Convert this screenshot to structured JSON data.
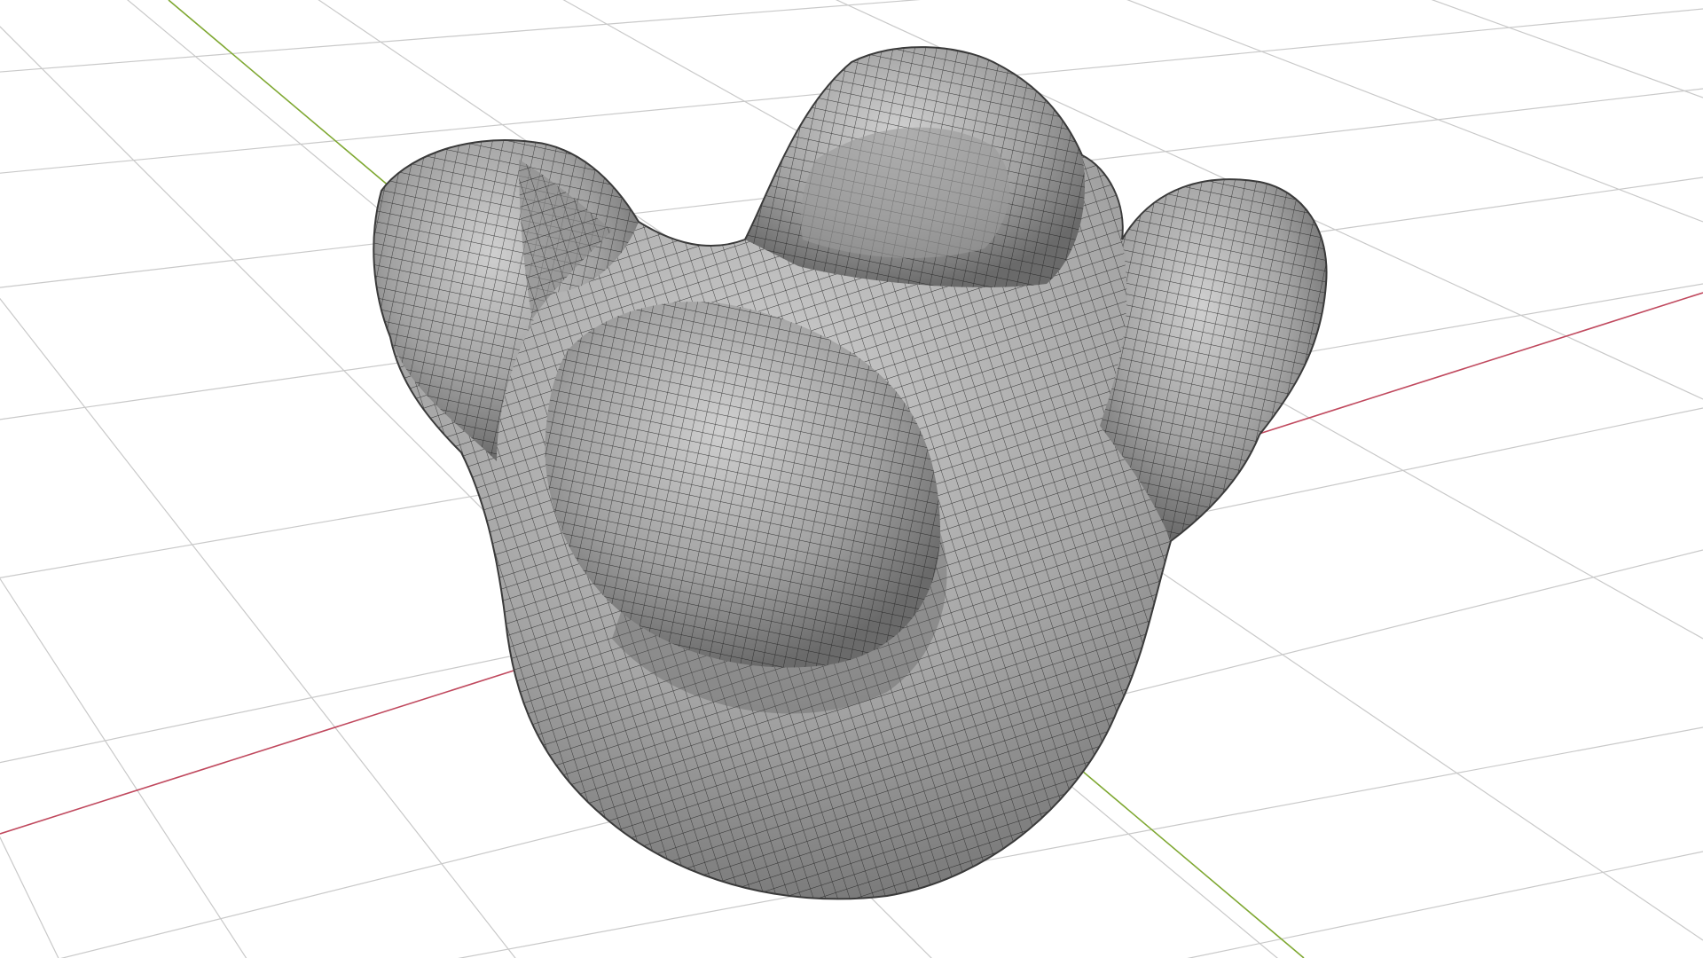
{
  "viewport": {
    "view": "3d-viewport",
    "background_color": "#ffffff",
    "grid_color": "#c9c9c9",
    "x_axis_color": "#c0495e",
    "y_axis_color": "#7fa832",
    "mesh_fill_color": "#a7a7a7",
    "mesh_wire_color": "#1e1e1e",
    "object": "sculpted-mesh-wireframe-overlay"
  }
}
